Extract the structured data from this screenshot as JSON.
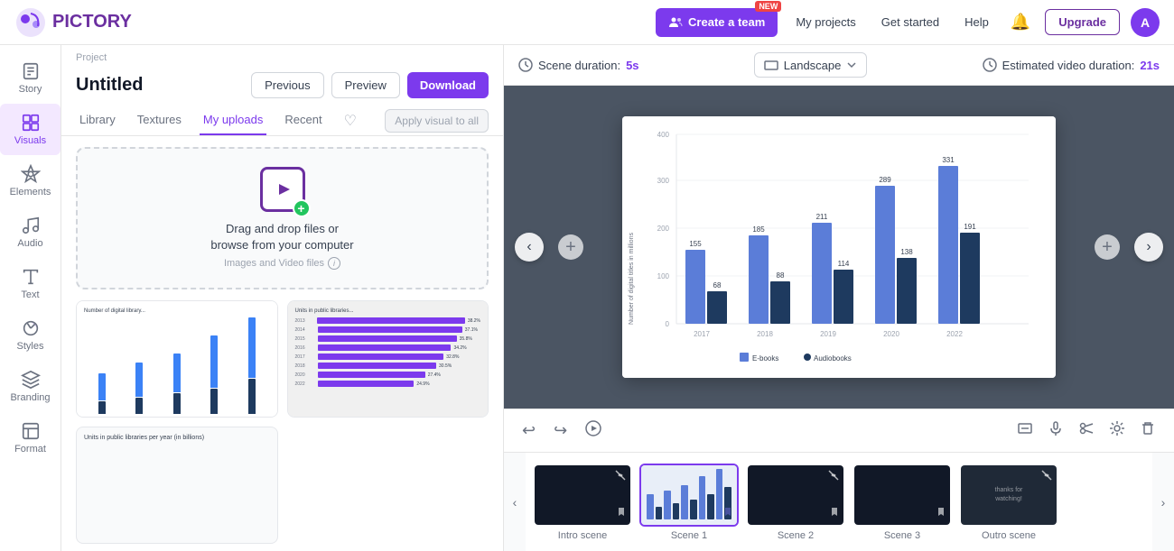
{
  "app": {
    "logo_text": "PICTORY",
    "nav_links": [
      "My projects",
      "Get started",
      "Help"
    ],
    "bell_label": "Notifications",
    "create_team_label": "Create a team",
    "new_badge": "NEW",
    "upgrade_label": "Upgrade",
    "avatar_letter": "A"
  },
  "sidebar": {
    "items": [
      {
        "id": "story",
        "label": "Story",
        "icon": "story-icon"
      },
      {
        "id": "visuals",
        "label": "Visuals",
        "icon": "visuals-icon"
      },
      {
        "id": "elements",
        "label": "Elements",
        "icon": "elements-icon"
      },
      {
        "id": "audio",
        "label": "Audio",
        "icon": "audio-icon"
      },
      {
        "id": "text",
        "label": "Text",
        "icon": "text-icon"
      },
      {
        "id": "styles",
        "label": "Styles",
        "icon": "styles-icon"
      },
      {
        "id": "branding",
        "label": "Branding",
        "icon": "branding-icon"
      },
      {
        "id": "format",
        "label": "Format",
        "icon": "format-icon"
      }
    ],
    "active_item": "visuals"
  },
  "project": {
    "label": "Project",
    "title": "Untitled"
  },
  "header_buttons": {
    "previous": "Previous",
    "preview": "Preview",
    "download": "Download"
  },
  "panel": {
    "tabs": [
      {
        "id": "library",
        "label": "Library"
      },
      {
        "id": "textures",
        "label": "Textures"
      },
      {
        "id": "my_uploads",
        "label": "My uploads"
      },
      {
        "id": "recent",
        "label": "Recent"
      }
    ],
    "active_tab": "my_uploads",
    "apply_visual_label": "Apply visual to all",
    "upload": {
      "primary_text": "Drag and drop files or",
      "secondary_text": "browse from your computer",
      "subtext": "Images and Video files"
    }
  },
  "canvas": {
    "scene_duration_label": "Scene duration:",
    "scene_duration_value": "5s",
    "orientation": "Landscape",
    "estimated_label": "Estimated video duration:",
    "estimated_value": "21s"
  },
  "timeline": {
    "scenes": [
      {
        "id": "intro",
        "label": "Intro scene",
        "selected": false,
        "type": "intro"
      },
      {
        "id": "scene1",
        "label": "Scene 1",
        "selected": true,
        "type": "chart"
      },
      {
        "id": "scene2",
        "label": "Scene 2",
        "selected": false,
        "type": "dark"
      },
      {
        "id": "scene3",
        "label": "Scene 3",
        "selected": false,
        "type": "dark"
      },
      {
        "id": "outro",
        "label": "Outro scene",
        "selected": false,
        "type": "outro"
      }
    ]
  },
  "chart": {
    "years": [
      "2017",
      "2018",
      "2019",
      "2020",
      "2022"
    ],
    "ebooks": [
      155,
      185,
      211,
      289,
      331
    ],
    "audiobooks": [
      68,
      88,
      114,
      138,
      191
    ],
    "legend": [
      "E-books",
      "Audiobooks"
    ],
    "y_axis": [
      0,
      100,
      200,
      300,
      400
    ],
    "y_label": "Number of digital titles in millions"
  }
}
